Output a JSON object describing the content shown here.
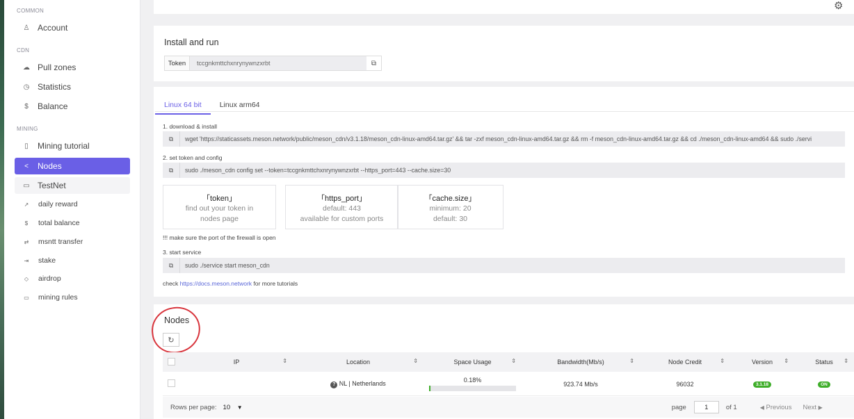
{
  "sidebar": {
    "sections": [
      {
        "label": "COMMON"
      },
      {
        "label": "CDN"
      },
      {
        "label": "MINING"
      }
    ],
    "items": [
      {
        "label": "Account",
        "icon": "user-icon",
        "glyph": "♙"
      },
      {
        "label": "Pull zones",
        "icon": "cloud-icon",
        "glyph": "☁"
      },
      {
        "label": "Statistics",
        "icon": "clock-icon",
        "glyph": "◷"
      },
      {
        "label": "Balance",
        "icon": "dollar-icon",
        "glyph": "$"
      },
      {
        "label": "Mining tutorial",
        "icon": "book-icon",
        "glyph": "▯"
      },
      {
        "label": "Nodes",
        "icon": "share-icon",
        "glyph": "<"
      },
      {
        "label": "TestNet",
        "icon": "folder-icon",
        "glyph": "▭"
      },
      {
        "label": "daily reward",
        "icon": "trend-icon",
        "glyph": "↗"
      },
      {
        "label": "total balance",
        "icon": "dollar-small-icon",
        "glyph": "$"
      },
      {
        "label": "msntt transfer",
        "icon": "transfer-icon",
        "glyph": "⇄"
      },
      {
        "label": "stake",
        "icon": "login-icon",
        "glyph": "⇥"
      },
      {
        "label": "airdrop",
        "icon": "drop-icon",
        "glyph": "◇"
      },
      {
        "label": "mining rules",
        "icon": "rules-icon",
        "glyph": "▭"
      }
    ],
    "active_item": "Nodes"
  },
  "install": {
    "title": "Install and run",
    "token_label": "Token",
    "token_value": "tccgnkmttchxnrynywnzxrbt"
  },
  "tutorial": {
    "tabs": [
      "Linux 64 bit",
      "Linux arm64"
    ],
    "active_tab": "Linux 64 bit",
    "step1_label": "1. download & install",
    "step1_cmd": "wget 'https://staticassets.meson.network/public/meson_cdn/v3.1.18/meson_cdn-linux-amd64.tar.gz' && tar -zxf meson_cdn-linux-amd64.tar.gz && rm -f meson_cdn-linux-amd64.tar.gz && cd ./meson_cdn-linux-amd64 && sudo ./servi",
    "step2_label": "2. set token and config",
    "step2_cmd": "sudo ./meson_cdn config set --token=tccgnkmttchxnrynywnzxrbt --https_port=443 --cache.size=30",
    "cards": [
      {
        "title": "「token」",
        "lines": [
          "find out your token in",
          "nodes page"
        ]
      },
      {
        "title": "「https_port」",
        "lines": [
          "default: 443",
          "available for custom ports"
        ]
      },
      {
        "title": "「cache.size」",
        "lines": [
          "minimum: 20",
          "default: 30"
        ]
      }
    ],
    "firewall_note": "!!! make sure the port of the firewall is open",
    "step3_label": "3. start service",
    "step3_cmd": "sudo ./service start meson_cdn",
    "docs_prefix": "check ",
    "docs_link": "https://docs.meson.network",
    "docs_suffix": " for more tutorials"
  },
  "nodes": {
    "title": "Nodes",
    "columns": [
      "IP",
      "Location",
      "Space Usage",
      "Bandwidth(Mb/s)",
      "Node Credit",
      "Version",
      "Status"
    ],
    "rows": [
      {
        "ip": "",
        "location": "NL | Netherlands",
        "space_usage": "0.18%",
        "space_usage_fraction": 0.0018,
        "bandwidth": "923.74 Mb/s",
        "credit": "96032",
        "version": "3.1.18",
        "status": "ON"
      }
    ],
    "rows_per_page_label": "Rows per page:",
    "rows_per_page": "10",
    "page_label": "page",
    "page": "1",
    "of_label": "of 1",
    "prev_label": "Previous",
    "next_label": "Next"
  },
  "colors": {
    "accent": "#6a5fe6",
    "ok": "#3fae2a",
    "annotation": "#d8343c"
  }
}
